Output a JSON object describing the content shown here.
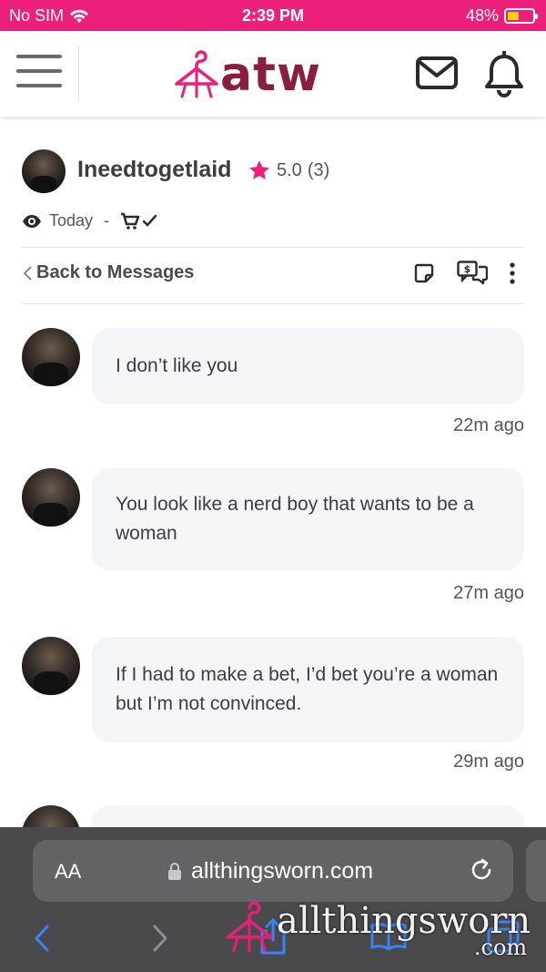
{
  "status_bar": {
    "carrier": "No SIM",
    "time": "2:39 PM",
    "battery": "48%",
    "battery_level": 0.48
  },
  "header": {
    "logo_text": "atw",
    "icons": [
      "menu-icon",
      "hanger-icon",
      "mail-icon",
      "bell-icon"
    ]
  },
  "profile": {
    "username": "Ineedtogetlaid",
    "rating": "5.0",
    "rating_count": "(3)",
    "last_seen": "Today",
    "separator": "-"
  },
  "nav": {
    "back_label": "Back to Messages"
  },
  "messages": [
    {
      "text": "I don’t like you",
      "time": "22m ago"
    },
    {
      "text": "You look like a nerd boy that wants to be a woman",
      "time": "27m ago"
    },
    {
      "text": "If I had to make a bet, I’d bet you’re a woman but I’m not convinced.",
      "time": "29m ago"
    }
  ],
  "browser": {
    "text_size_label": "AA",
    "url": "allthingsworn.com"
  },
  "watermark": {
    "text": "allthingsworn",
    "suffix": ".com"
  },
  "colors": {
    "brand_pink": "#ec1f7a",
    "brand_maroon": "#8b1e3f",
    "bubble_bg": "#f4f5f7",
    "safari_bar": "#4a4a4c",
    "link_blue": "#3a82f7"
  }
}
